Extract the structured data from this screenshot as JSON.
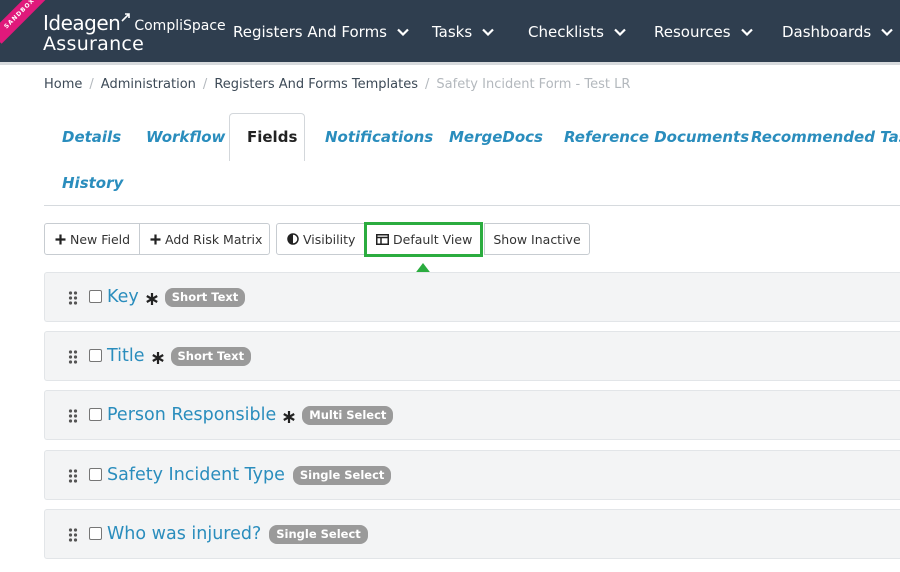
{
  "environment_ribbon": "SANDBOX",
  "logo": {
    "brand": "Ideagen",
    "product_suffix": "CompliSpace",
    "product": "Assurance"
  },
  "nav": {
    "items": [
      {
        "label": "Registers And Forms"
      },
      {
        "label": "Tasks"
      },
      {
        "label": "Checklists"
      },
      {
        "label": "Resources"
      },
      {
        "label": "Dashboards"
      }
    ]
  },
  "breadcrumb": {
    "items": [
      {
        "label": "Home"
      },
      {
        "label": "Administration"
      },
      {
        "label": "Registers And Forms Templates"
      },
      {
        "label": "Safety Incident Form - Test LR"
      }
    ],
    "separator": "/"
  },
  "tabs": {
    "items": [
      {
        "label": "Details"
      },
      {
        "label": "Workflow"
      },
      {
        "label": "Fields"
      },
      {
        "label": "Notifications"
      },
      {
        "label": "MergeDocs"
      },
      {
        "label": "Reference Documents"
      },
      {
        "label": "Recommended Tasks"
      },
      {
        "label": "History"
      }
    ],
    "active": "Fields"
  },
  "toolbar": {
    "new_field": "New Field",
    "add_risk_matrix": "Add Risk Matrix",
    "visibility": "Visibility",
    "default_view": "Default View",
    "show_inactive": "Show Inactive"
  },
  "fields": [
    {
      "name": "Key",
      "required": true,
      "type": "Short Text"
    },
    {
      "name": "Title",
      "required": true,
      "type": "Short Text"
    },
    {
      "name": "Person Responsible",
      "required": true,
      "type": "Multi Select"
    },
    {
      "name": "Safety Incident Type",
      "required": false,
      "type": "Single Select"
    },
    {
      "name": "Who was injured?",
      "required": false,
      "type": "Single Select"
    }
  ],
  "colors": {
    "topbar": "#2f3e4f",
    "ribbon": "#e0197b",
    "link": "#2a8dbd",
    "highlight": "#2bac3f",
    "badge": "#9a9a9a"
  },
  "icons": {
    "new_field": "plus-icon",
    "add_risk_matrix": "plus-icon",
    "visibility": "half-circle-icon",
    "default_view": "table-layout-icon",
    "grip": "drag-handle-icon",
    "required": "asterisk-icon",
    "nav_dropdown": "chevron-down-icon",
    "annotation": "up-arrow-icon"
  }
}
